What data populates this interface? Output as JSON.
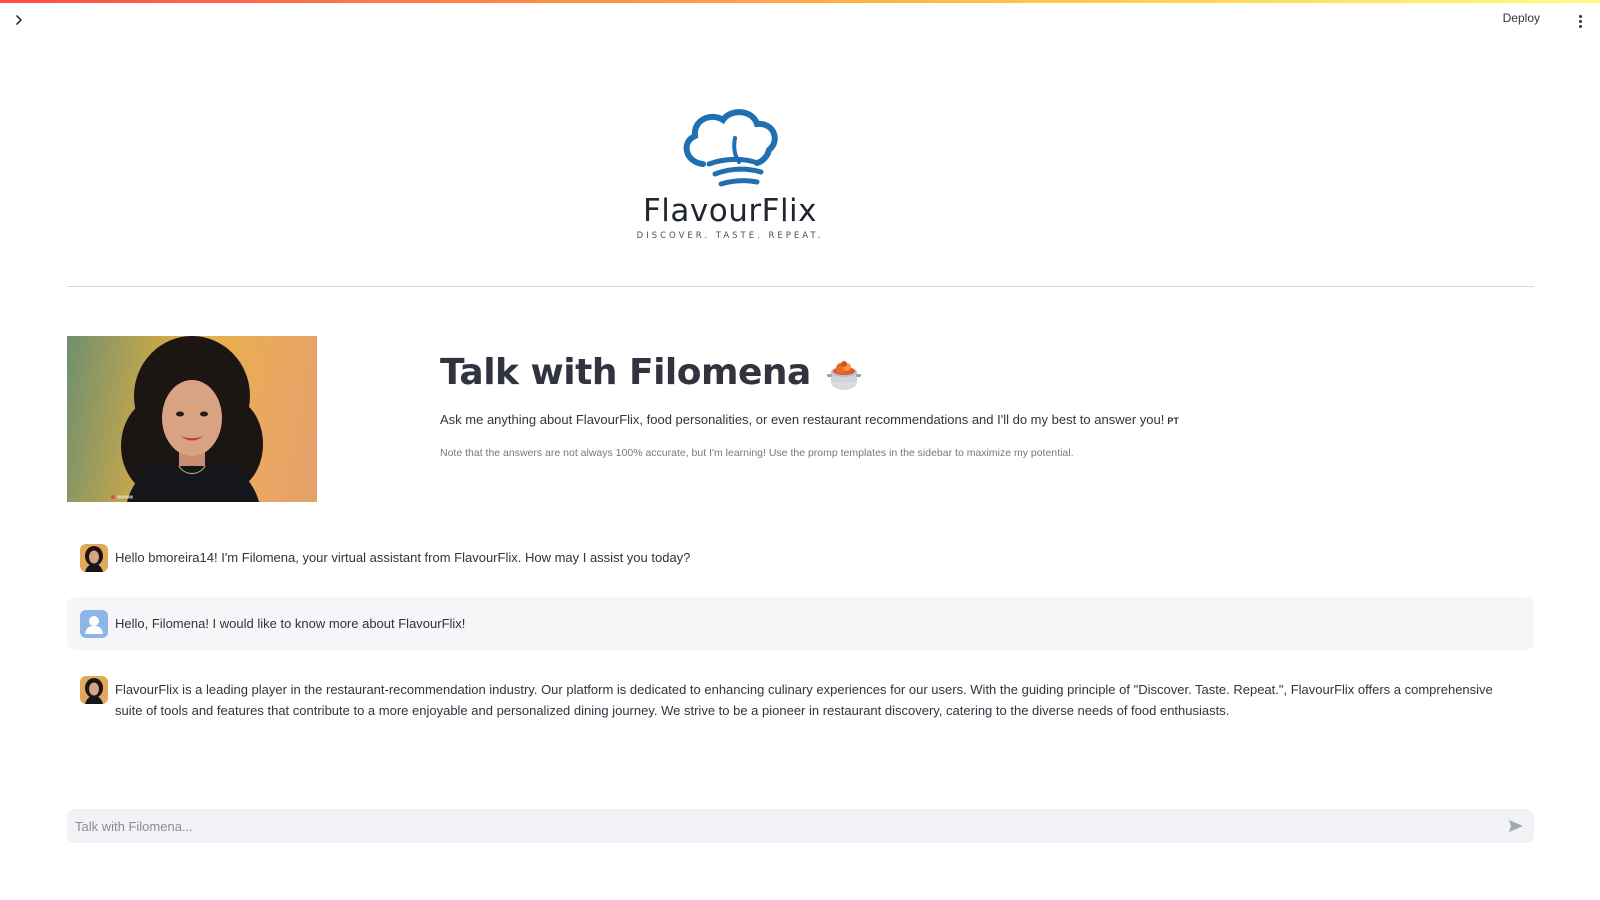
{
  "header": {
    "deploy_label": "Deploy"
  },
  "logo": {
    "brand": "FlavourFlix",
    "tagline": "DISCOVER. TASTE. REPEAT."
  },
  "intro": {
    "title": "Talk with Filomena",
    "subtitle": "Ask me anything about FlavourFlix, food personalities, or even restaurant recommendations and I'll do my best to answer you!",
    "language_tag": "PT",
    "note": "Note that the answers are not always 100% accurate, but I'm learning! Use the promp templates in the sidebar to maximize my potential."
  },
  "messages": [
    {
      "role": "assistant",
      "text": "Hello bmoreira14! I'm Filomena, your virtual assistant from FlavourFlix. How may I assist you today?"
    },
    {
      "role": "user",
      "text": "Hello, Filomena! I would like to know more about FlavourFlix!"
    },
    {
      "role": "assistant",
      "text": "FlavourFlix is a leading player in the restaurant-recommendation industry. Our platform is dedicated to enhancing culinary experiences for our users. With the guiding principle of \"Discover. Taste. Repeat.\", FlavourFlix offers a comprehensive suite of tools and features that contribute to a more enjoyable and personalized dining journey. We strive to be a pioneer in restaurant discovery, catering to the diverse needs of food enthusiasts."
    }
  ],
  "chat_input": {
    "placeholder": "Talk with Filomena..."
  },
  "icons": {
    "sidebar_toggle": "chevron-right-icon",
    "menu": "vertical-dots-icon",
    "send": "send-icon",
    "title_emoji": "cooking-pot-icon"
  },
  "colors": {
    "brand_blue": "#1f6fb2",
    "top_gradient_start": "#ff4b4b",
    "top_gradient_end": "#fffd80",
    "user_bubble_bg": "#f5f6f8",
    "input_bg": "#f0f2f6"
  }
}
